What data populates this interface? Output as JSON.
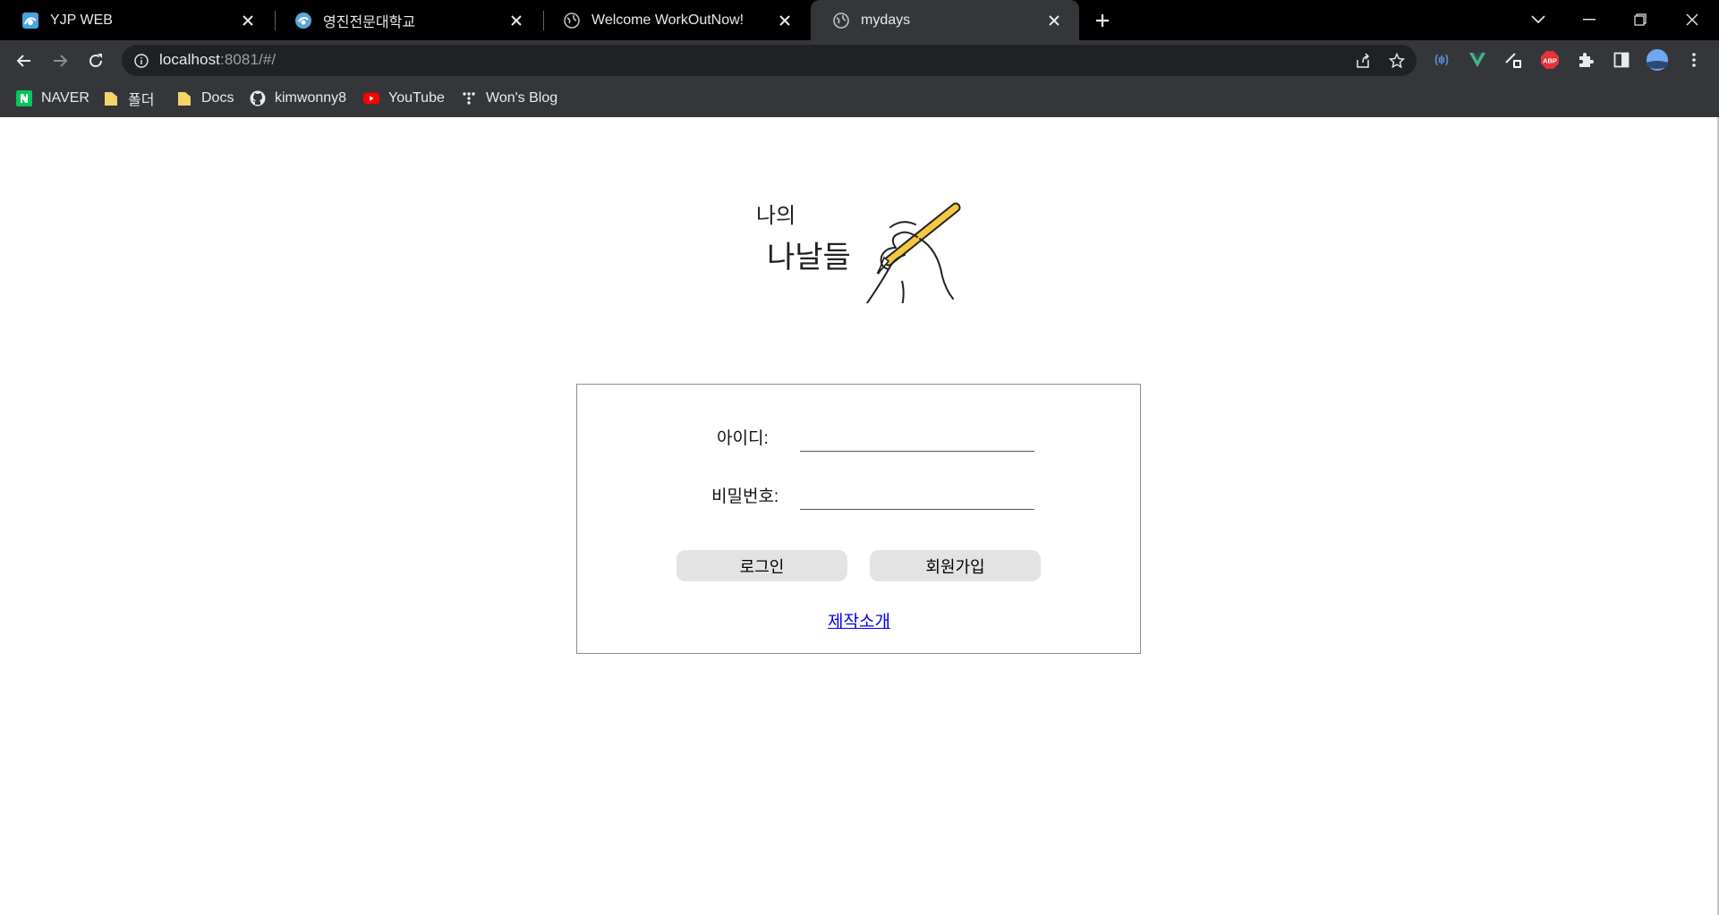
{
  "browser": {
    "tabs": [
      {
        "title": "YJP WEB",
        "icon": "yjp-logo-icon",
        "active": false
      },
      {
        "title": "영진전문대학교",
        "icon": "yeungjin-logo-icon",
        "active": false
      },
      {
        "title": "Welcome WorkOutNow!",
        "icon": "globe-icon",
        "active": false
      },
      {
        "title": "mydays",
        "icon": "globe-icon",
        "active": true
      }
    ],
    "address": {
      "host": "localhost",
      "rest": ":8081/#/"
    },
    "bookmarks": [
      {
        "label": "NAVER",
        "icon": "naver-icon"
      },
      {
        "label": "폴더",
        "icon": "folder-icon"
      },
      {
        "label": "Docs",
        "icon": "folder-icon"
      },
      {
        "label": "kimwonny8",
        "icon": "github-icon"
      },
      {
        "label": "YouTube",
        "icon": "youtube-icon"
      },
      {
        "label": "Won's Blog",
        "icon": "tistory-icon"
      }
    ],
    "extensions": [
      "broadcast-icon",
      "vue-devtools-icon",
      "pen-extension-icon",
      "adblock-plus-icon",
      "puzzle-icon",
      "side-panel-icon",
      "profile-avatar-icon",
      "more-menu-icon"
    ],
    "abp_label": "ABP"
  },
  "logo": {
    "line1": "나의",
    "line2": "나날들"
  },
  "login": {
    "id_label": "아이디:",
    "id_value": "",
    "password_label": "비밀번호:",
    "password_value": "",
    "login_button": "로그인",
    "signup_button": "회원가입",
    "about_link": "제작소개"
  },
  "colors": {
    "tab_bar": "#000000",
    "toolbar": "#35363a",
    "omnibox": "#202124",
    "link": "#0000ee",
    "button": "#e3e3e3",
    "pencil": "#f5c842"
  }
}
